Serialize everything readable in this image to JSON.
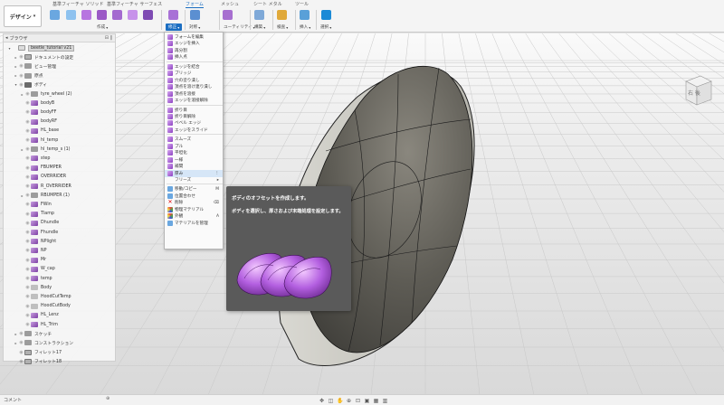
{
  "toolbar": {
    "design_label": "デザイン",
    "workspace_tabs": [
      "基準フィーチャ ソリッド",
      "基準フィーチャ サーフェス",
      "フォーム",
      "メッシュ",
      "シート メタル",
      "ツール"
    ],
    "active_tab": "フォーム",
    "groups": [
      {
        "label": "作成"
      },
      {
        "label": "修正",
        "active": true
      },
      {
        "label": "対称"
      },
      {
        "label": "ユーティリティ"
      },
      {
        "label": "構築"
      },
      {
        "label": "検査"
      },
      {
        "label": "挿入"
      },
      {
        "label": "選択"
      }
    ]
  },
  "browser": {
    "title": "ブラウザ",
    "items": [
      {
        "label": "beetle_tutorial v21",
        "level": 0,
        "icon": "doc",
        "arrow": "▾",
        "root": true
      },
      {
        "label": "ドキュメントの設定",
        "level": 1,
        "icon": "comp",
        "arrow": "▸"
      },
      {
        "label": "ビュー管理",
        "level": 1,
        "icon": "folder",
        "arrow": "▸"
      },
      {
        "label": "原点",
        "level": 1,
        "icon": "folder",
        "arrow": "▸"
      },
      {
        "label": "ボディ",
        "level": 1,
        "icon": "folder-dark",
        "arrow": "▾"
      },
      {
        "label": "tyre_wheel (2)",
        "level": 2,
        "icon": "folder",
        "arrow": "▸"
      },
      {
        "label": "bodyB",
        "level": 2,
        "icon": "body"
      },
      {
        "label": "bodyFF",
        "level": 2,
        "icon": "body"
      },
      {
        "label": "bodyRF",
        "level": 2,
        "icon": "body"
      },
      {
        "label": "HL_base",
        "level": 2,
        "icon": "body"
      },
      {
        "label": "hl_temp",
        "level": 2,
        "icon": "body"
      },
      {
        "label": "hl_temp_s (1)",
        "level": 2,
        "icon": "folder",
        "arrow": "▸"
      },
      {
        "label": "step",
        "level": 2,
        "icon": "body"
      },
      {
        "label": "FBUMPER",
        "level": 2,
        "icon": "body"
      },
      {
        "label": "OVERRIDER",
        "level": 2,
        "icon": "body"
      },
      {
        "label": "R_OVERRIDER",
        "level": 2,
        "icon": "body"
      },
      {
        "label": "RBUMPER (1)",
        "level": 2,
        "icon": "folder",
        "arrow": "▸"
      },
      {
        "label": "FWin",
        "level": 2,
        "icon": "body"
      },
      {
        "label": "Tlamp",
        "level": 2,
        "icon": "body"
      },
      {
        "label": "Dhundle",
        "level": 2,
        "icon": "body"
      },
      {
        "label": "Fhundle",
        "level": 2,
        "icon": "body"
      },
      {
        "label": "NPlight",
        "level": 2,
        "icon": "body"
      },
      {
        "label": "NP",
        "level": 2,
        "icon": "body"
      },
      {
        "label": "Mr",
        "level": 2,
        "icon": "body"
      },
      {
        "label": "W_cap",
        "level": 2,
        "icon": "body"
      },
      {
        "label": "temp",
        "level": 2,
        "icon": "body"
      },
      {
        "label": "Body",
        "level": 2,
        "icon": "plane"
      },
      {
        "label": "HoodCutTemp",
        "level": 2,
        "icon": "plane"
      },
      {
        "label": "HoodCutBody",
        "level": 2,
        "icon": "plane"
      },
      {
        "label": "HL_Lenz",
        "level": 2,
        "icon": "body"
      },
      {
        "label": "HL_Trim",
        "level": 2,
        "icon": "body"
      },
      {
        "label": "スケッチ",
        "level": 1,
        "icon": "folder",
        "arrow": "▸"
      },
      {
        "label": "コンストラクション",
        "level": 1,
        "icon": "folder",
        "arrow": "▸"
      },
      {
        "label": "フィレット17",
        "level": 1,
        "icon": "comp"
      },
      {
        "label": "フィレット18",
        "level": 1,
        "icon": "comp"
      }
    ]
  },
  "modify_menu": {
    "items": [
      {
        "label": "フォームを編集",
        "icon": "form"
      },
      {
        "label": "エッジを挿入",
        "icon": "form"
      },
      {
        "label": "再分割",
        "icon": "form"
      },
      {
        "label": "挿入点",
        "icon": "form"
      },
      {
        "sep": true
      },
      {
        "label": "エッジを結合",
        "icon": "form"
      },
      {
        "label": "ブリッジ",
        "icon": "form"
      },
      {
        "label": "穴の塗り潰し",
        "icon": "form"
      },
      {
        "label": "頂点を溶け連り潰し",
        "icon": "form"
      },
      {
        "label": "頂点を溶接",
        "icon": "form"
      },
      {
        "label": "エッジを溶接解除",
        "icon": "form"
      },
      {
        "sep": true
      },
      {
        "label": "折り目",
        "icon": "form"
      },
      {
        "label": "折り目解除",
        "icon": "form"
      },
      {
        "label": "ベベル エッジ",
        "icon": "form"
      },
      {
        "label": "エッジをスライド",
        "icon": "form"
      },
      {
        "sep": true
      },
      {
        "label": "スムーズ",
        "icon": "form"
      },
      {
        "label": "プル",
        "icon": "form"
      },
      {
        "label": "平坦化",
        "icon": "form"
      },
      {
        "label": "一様",
        "icon": "form"
      },
      {
        "label": "補間",
        "icon": "form"
      },
      {
        "label": "厚み",
        "icon": "form",
        "highlight": true,
        "shortcut": "⋮"
      },
      {
        "label": "フリーズ",
        "icon": "none",
        "shortcut": "▸"
      },
      {
        "sep": true
      },
      {
        "label": "移動/コピー",
        "icon": "blue",
        "shortcut": "M"
      },
      {
        "label": "位置合わせ",
        "icon": "blue"
      },
      {
        "label": "削除",
        "icon": "red",
        "shortcut": "⌫"
      },
      {
        "label": "物理マテリアル",
        "icon": "multi"
      },
      {
        "label": "外観",
        "icon": "multi",
        "shortcut": "A"
      },
      {
        "label": "マテリアルを管理",
        "icon": "doc"
      }
    ]
  },
  "tooltip": {
    "title": "ボディのオフセットを作成します。",
    "description": "ボディを選択し、厚さおよび末端処理を設定します。"
  },
  "viewcube": {
    "label": "右 後"
  },
  "bottom": {
    "comment_label": "コメント"
  }
}
